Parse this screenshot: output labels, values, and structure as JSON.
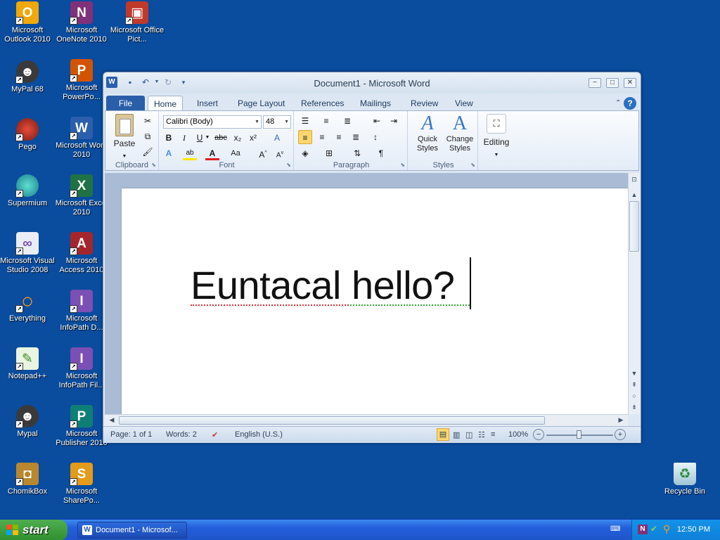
{
  "desktop": {
    "icons": [
      {
        "label": "Microsoft Outlook 2010",
        "icon": "outlook-icon"
      },
      {
        "label": "Microsoft OneNote 2010",
        "icon": "onenote-icon"
      },
      {
        "label": "Microsoft Office Pict...",
        "icon": "picture-manager-icon"
      },
      {
        "label": "MyPal 68",
        "icon": "raccoon-icon"
      },
      {
        "label": "Microsoft PowerPo...",
        "icon": "powerpoint-icon"
      },
      {
        "label": "Pego",
        "icon": "pego-icon"
      },
      {
        "label": "Microsoft Word 2010",
        "icon": "word-icon"
      },
      {
        "label": "Supermium",
        "icon": "supermium-icon"
      },
      {
        "label": "Microsoft Excel 2010",
        "icon": "excel-icon"
      },
      {
        "label": "Microsoft Visual Studio 2008",
        "icon": "visual-studio-icon"
      },
      {
        "label": "Microsoft Access 2010",
        "icon": "access-icon"
      },
      {
        "label": "Everything",
        "icon": "everything-icon"
      },
      {
        "label": "Microsoft InfoPath D...",
        "icon": "infopath-icon"
      },
      {
        "label": "Notepad++",
        "icon": "notepadpp-icon"
      },
      {
        "label": "Microsoft InfoPath Fil...",
        "icon": "infopath-icon"
      },
      {
        "label": "Mypal",
        "icon": "raccoon-icon"
      },
      {
        "label": "Microsoft Publisher 2010",
        "icon": "publisher-icon"
      },
      {
        "label": "ChomikBox",
        "icon": "chomikbox-icon"
      },
      {
        "label": "Microsoft SharePo...",
        "icon": "sharepoint-icon"
      },
      {
        "label": "Recycle Bin",
        "icon": "recycle-bin-icon"
      }
    ]
  },
  "word": {
    "title": "Document1 - Microsoft Word",
    "tabs": [
      "File",
      "Home",
      "Insert",
      "Page Layout",
      "References",
      "Mailings",
      "Review",
      "View"
    ],
    "active_tab": "Home",
    "ribbon": {
      "clipboard": {
        "label": "Clipboard",
        "paste": "Paste"
      },
      "font": {
        "label": "Font",
        "family": "Calibri (Body)",
        "size": "48"
      },
      "paragraph": {
        "label": "Paragraph"
      },
      "styles": {
        "label": "Styles",
        "quick": "Quick Styles",
        "change": "Change Styles"
      },
      "editing": {
        "label": "Editing"
      }
    },
    "document_text": "Euntacal hello?",
    "status": {
      "page": "Page: 1 of 1",
      "words": "Words: 2",
      "language": "English (U.S.)",
      "zoom": "100%"
    }
  },
  "taskbar": {
    "start": "start",
    "task": "Document1 - Microsof...",
    "clock": "12:50 PM"
  },
  "colors": {
    "desktop": "#0a4c9e",
    "file_tab": "#2a5ea8",
    "taskbar": "#245edb",
    "start": "#3a9b3a"
  }
}
